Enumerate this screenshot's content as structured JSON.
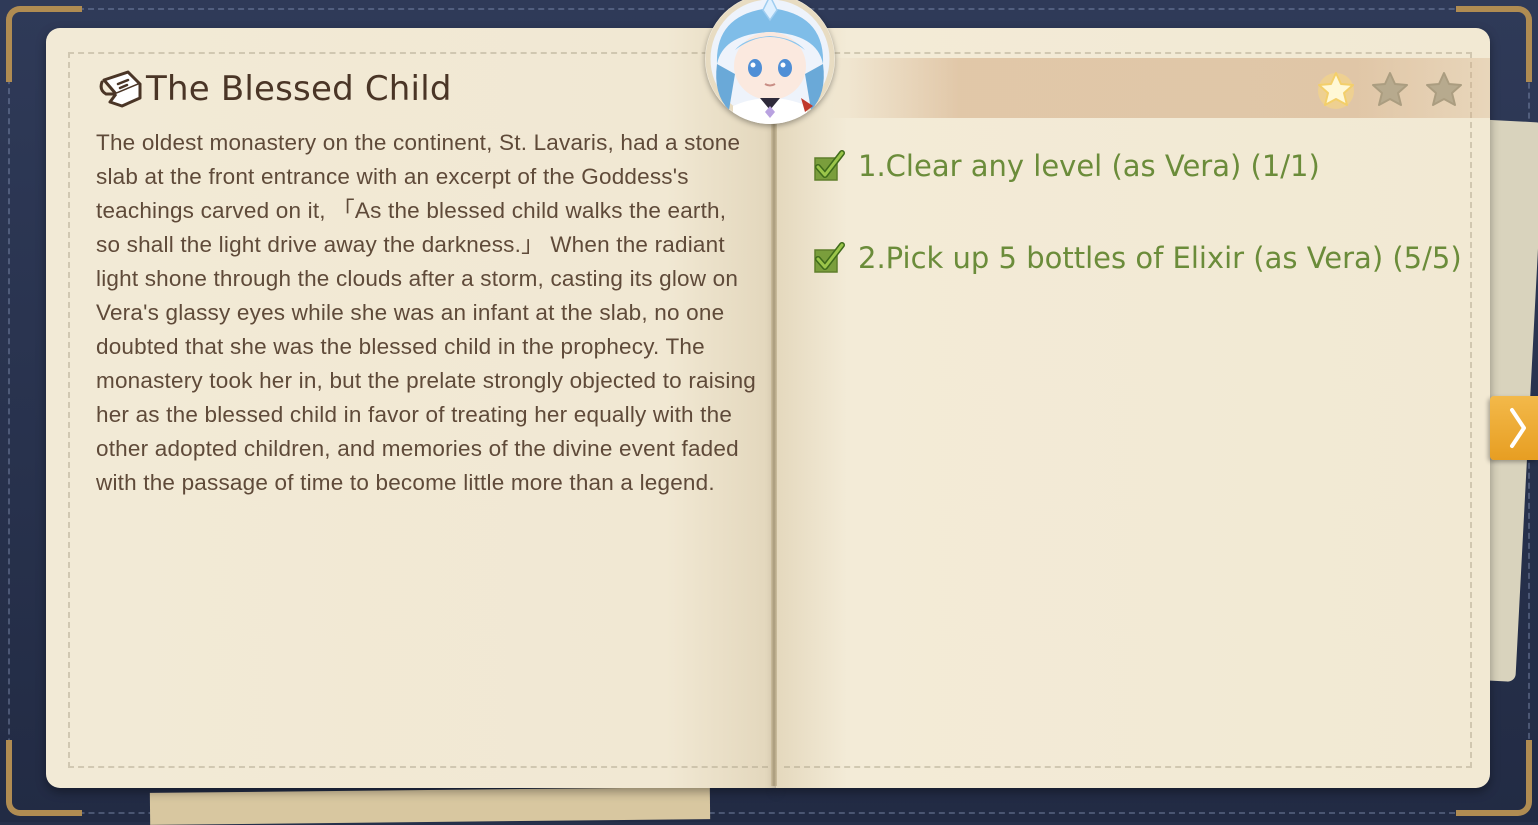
{
  "book": {
    "title": "The Blessed Child",
    "story": "The oldest monastery on the continent, St. Lavaris, had a stone slab at the front entrance with an excerpt of the Goddess's teachings carved on it, 「As the blessed child walks the earth, so shall the light drive away the darkness.」 When the radiant light shone through the clouds after a storm, casting its glow on Vera's glassy eyes while she was an infant at the slab, no one doubted that she was the blessed child in the prophecy. The monastery took her in, but the prelate strongly objected to raising her as the blessed child in favor of treating her equally with the other adopted children, and memories of the divine event faded with the passage of time to become little more than a legend."
  },
  "quests": [
    {
      "label": "1.Clear any level (as Vera) (1/1)",
      "completed": true
    },
    {
      "label": "2.Pick up 5 bottles of Elixir (as Vera) (5/5)",
      "completed": true
    }
  ],
  "stars": {
    "earned": 1,
    "total": 3
  },
  "colors": {
    "cover": "#26304a",
    "paper": "#f1e8d3",
    "title_text": "#4a3526",
    "body_text": "#5f4a39",
    "quest_text": "#6b8c3a",
    "star_earned": "#fff7cc",
    "star_empty": "#b7aa8e",
    "next_tab": "#e9a32a"
  },
  "icons": {
    "title": "scroll-icon",
    "quest_check": "checkmark-icon",
    "next": "chevron-right-icon",
    "portrait": "character-portrait"
  }
}
